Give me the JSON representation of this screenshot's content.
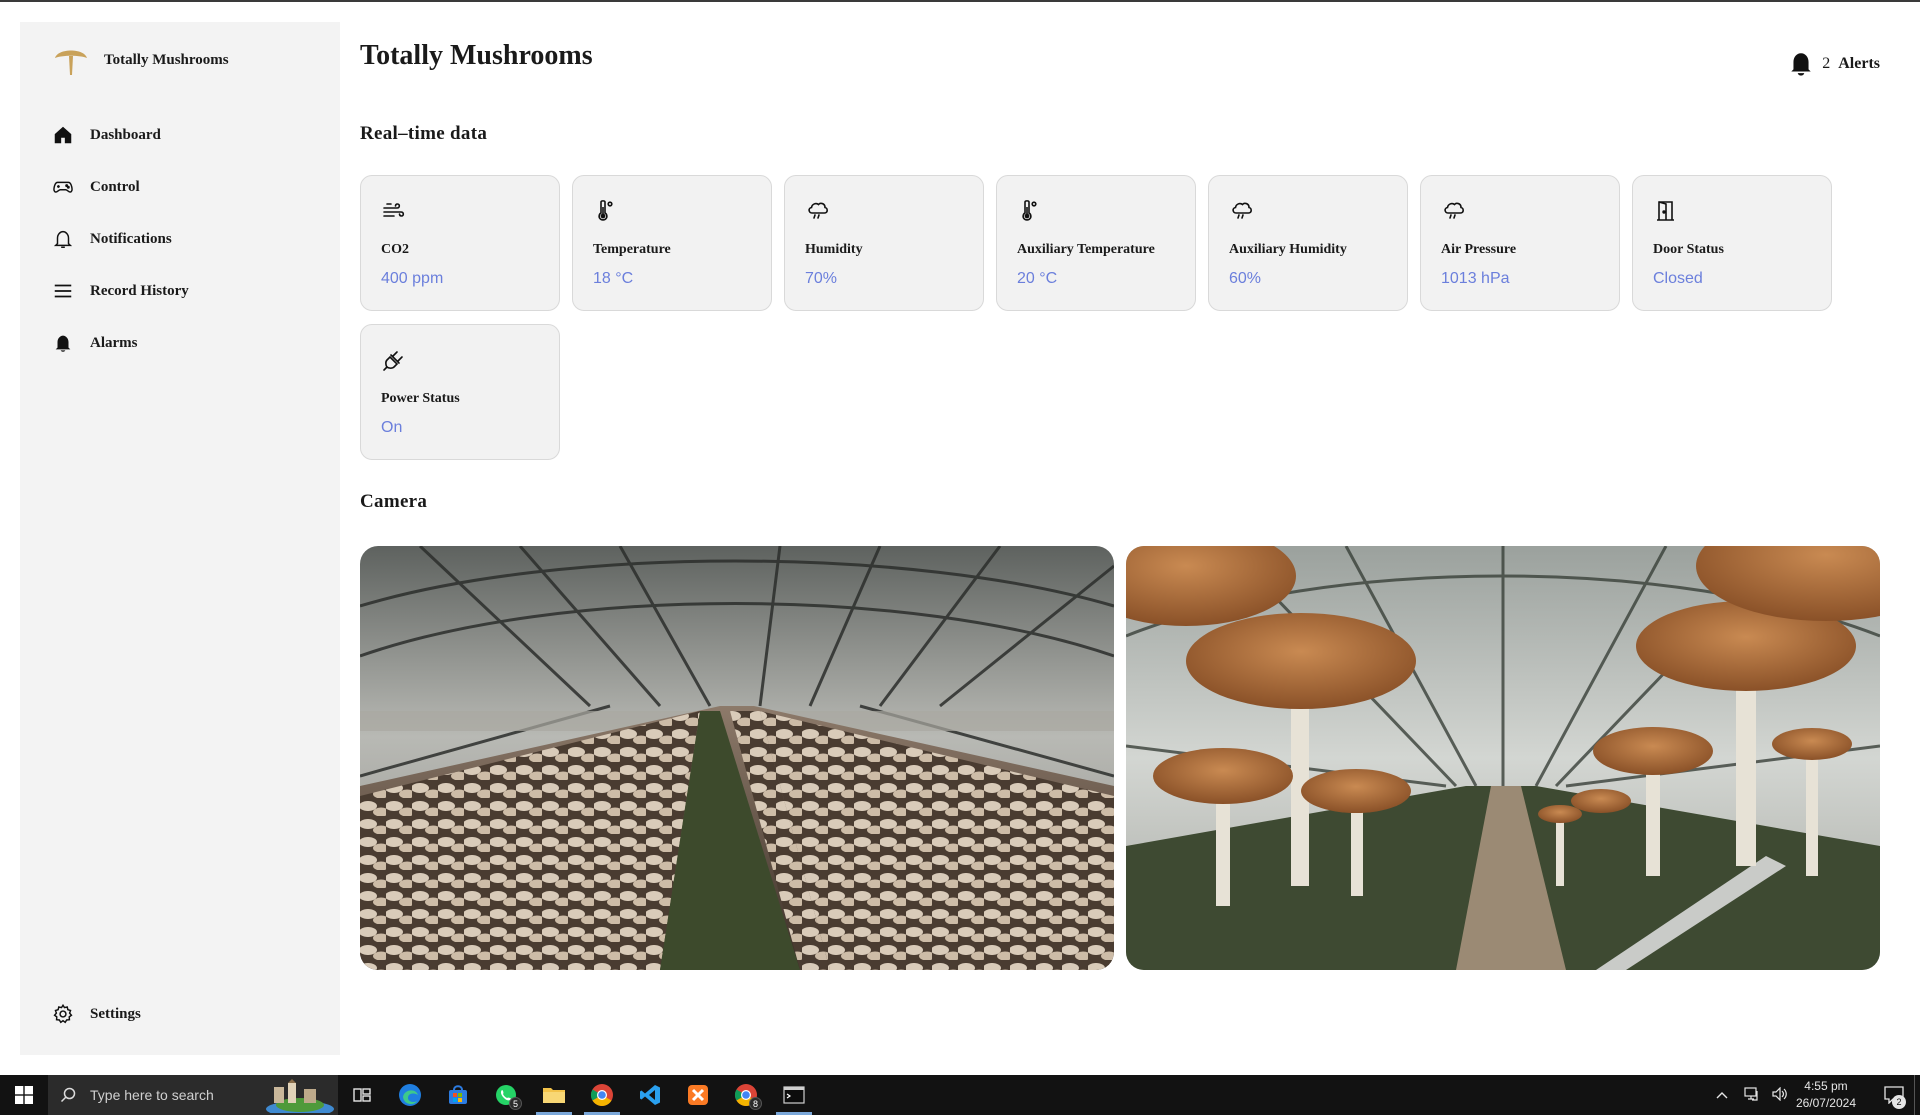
{
  "brand": {
    "name": "Totally Mushrooms",
    "logo_icon": "mushroom-logo-icon",
    "logo_color": "#c9a25a"
  },
  "sidebar": {
    "items": [
      {
        "label": "Dashboard",
        "icon": "home-icon"
      },
      {
        "label": "Control",
        "icon": "gamepad-icon"
      },
      {
        "label": "Notifications",
        "icon": "bell-outline-icon"
      },
      {
        "label": "Record History",
        "icon": "menu-icon"
      },
      {
        "label": "Alarms",
        "icon": "bell-filled-icon"
      }
    ],
    "settings": {
      "label": "Settings",
      "icon": "gear-icon"
    }
  },
  "header": {
    "title": "Totally Mushrooms",
    "alerts_count": "2",
    "alerts_label": "Alerts"
  },
  "realtime": {
    "title": "Real–time data",
    "cards": [
      {
        "label": "CO2",
        "value": "400 ppm",
        "icon": "wind-icon"
      },
      {
        "label": "Temperature",
        "value": "18 °C",
        "icon": "thermometer-icon"
      },
      {
        "label": "Humidity",
        "value": "70%",
        "icon": "cloud-rain-icon"
      },
      {
        "label": "Auxiliary Temperature",
        "value": "20 °C",
        "icon": "thermometer-icon"
      },
      {
        "label": "Auxiliary Humidity",
        "value": "60%",
        "icon": "cloud-rain-icon"
      },
      {
        "label": "Air Pressure",
        "value": "1013 hPa",
        "icon": "cloud-rain-icon"
      },
      {
        "label": "Door Status",
        "value": "Closed",
        "icon": "door-icon"
      },
      {
        "label": "Power Status",
        "value": "On",
        "icon": "plug-icon"
      }
    ],
    "value_color": "#6b7fdc"
  },
  "camera": {
    "title": "Camera",
    "feeds": [
      "camera-feed-greenhouse-rows",
      "camera-feed-closeup-mushrooms"
    ]
  },
  "taskbar": {
    "search_placeholder": "Type here to search",
    "apps": [
      "task-view-icon",
      "edge-icon",
      "store-icon",
      "whatsapp-icon",
      "file-explorer-icon",
      "chrome-icon",
      "vscode-icon",
      "xampp-icon",
      "chrome-icon",
      "terminal-icon"
    ],
    "whatsapp_badge": "5",
    "chrome_badge": "8",
    "time": "4:55 pm",
    "date": "26/07/2024",
    "notification_count": "2"
  }
}
